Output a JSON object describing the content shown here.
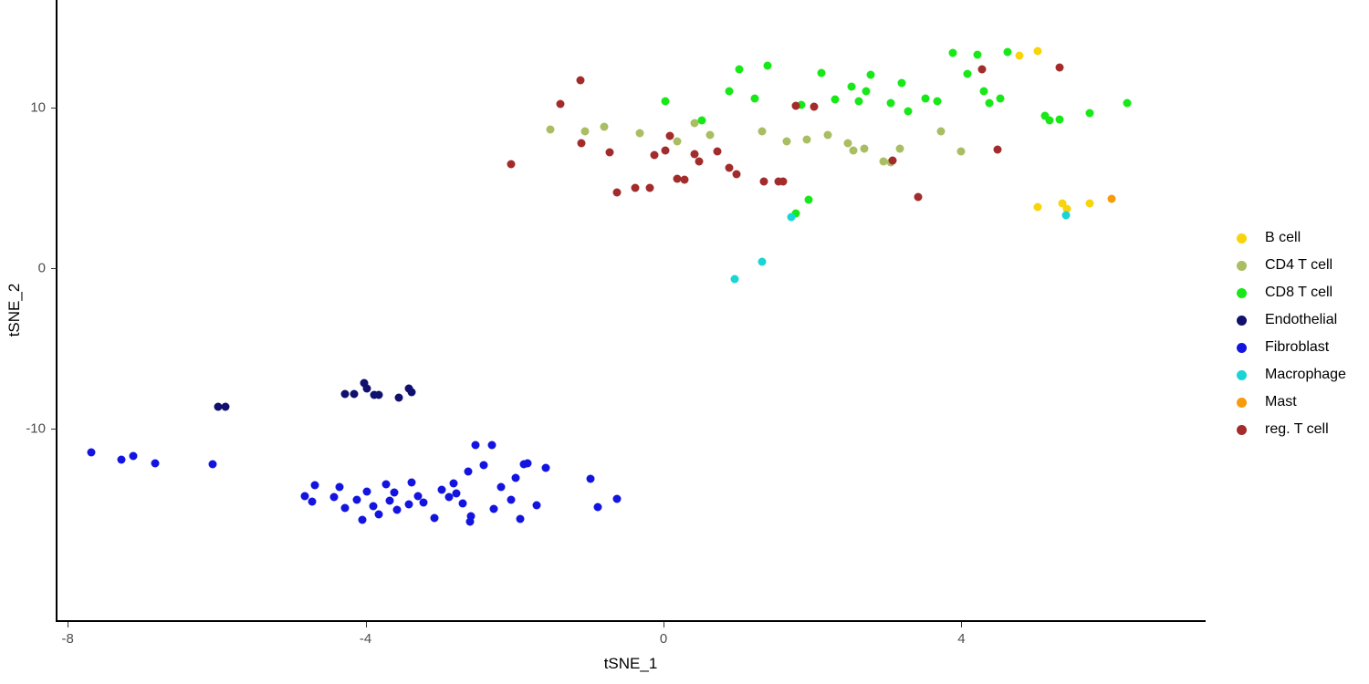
{
  "chart_data": {
    "type": "scatter",
    "title": "",
    "xlabel": "tSNE_1",
    "ylabel": "tSNE_2",
    "xlim": [
      -8.75,
      6.5
    ],
    "ylim": [
      -16.8,
      14.5
    ],
    "xticks": [
      -8,
      -4,
      0,
      4
    ],
    "xticklabels": [
      "-8",
      "-4",
      "0",
      "4"
    ],
    "yticks": [
      -10,
      0,
      10
    ],
    "yticklabels": [
      "-10",
      "0",
      "10"
    ],
    "grid": false,
    "legend_position": "right",
    "point_size": 9,
    "series": [
      {
        "name": "B cell",
        "color": "#f7d40c",
        "points": [
          [
            4.78,
            13.25
          ],
          [
            5.02,
            13.55
          ],
          [
            5.02,
            3.82
          ],
          [
            5.35,
            4.02
          ],
          [
            5.42,
            3.7
          ],
          [
            5.72,
            4.05
          ]
        ]
      },
      {
        "name": "CD4 T cell",
        "color": "#a9bd62",
        "points": [
          [
            -1.52,
            8.65
          ],
          [
            -1.05,
            8.5
          ],
          [
            -0.8,
            8.78
          ],
          [
            -0.32,
            8.4
          ],
          [
            0.18,
            7.92
          ],
          [
            0.42,
            9.02
          ],
          [
            0.62,
            8.3
          ],
          [
            1.32,
            8.55
          ],
          [
            1.65,
            7.88
          ],
          [
            1.92,
            8.02
          ],
          [
            2.2,
            8.28
          ],
          [
            2.48,
            7.78
          ],
          [
            2.55,
            7.32
          ],
          [
            2.7,
            7.42
          ],
          [
            2.95,
            6.62
          ],
          [
            3.05,
            6.6
          ],
          [
            3.18,
            7.45
          ],
          [
            3.72,
            8.5
          ],
          [
            4.0,
            7.25
          ]
        ]
      },
      {
        "name": "CD8 T cell",
        "color": "#18e818",
        "points": [
          [
            0.02,
            10.42
          ],
          [
            0.52,
            9.2
          ],
          [
            0.88,
            11.05
          ],
          [
            1.02,
            12.4
          ],
          [
            1.22,
            10.55
          ],
          [
            1.4,
            12.62
          ],
          [
            1.85,
            10.15
          ],
          [
            2.12,
            12.15
          ],
          [
            2.3,
            10.52
          ],
          [
            2.52,
            11.32
          ],
          [
            2.62,
            10.4
          ],
          [
            2.72,
            11.05
          ],
          [
            2.78,
            12.05
          ],
          [
            3.05,
            10.28
          ],
          [
            3.2,
            11.55
          ],
          [
            3.28,
            9.78
          ],
          [
            3.52,
            10.58
          ],
          [
            3.68,
            10.42
          ],
          [
            3.88,
            13.4
          ],
          [
            4.08,
            12.08
          ],
          [
            4.22,
            13.3
          ],
          [
            4.3,
            11.05
          ],
          [
            4.38,
            10.3
          ],
          [
            4.52,
            10.55
          ],
          [
            4.62,
            13.45
          ],
          [
            5.12,
            9.48
          ],
          [
            5.18,
            9.2
          ],
          [
            5.32,
            9.25
          ],
          [
            5.72,
            9.65
          ],
          [
            6.22,
            10.28
          ],
          [
            1.95,
            4.28
          ],
          [
            1.78,
            3.42
          ]
        ]
      },
      {
        "name": "Endothelial",
        "color": "#10106e",
        "points": [
          [
            -5.98,
            -8.62
          ],
          [
            -5.88,
            -8.62
          ],
          [
            -4.28,
            -7.85
          ],
          [
            -4.15,
            -7.82
          ],
          [
            -4.02,
            -7.15
          ],
          [
            -3.98,
            -7.52
          ],
          [
            -3.88,
            -7.88
          ],
          [
            -3.82,
            -7.88
          ],
          [
            -3.55,
            -8.05
          ],
          [
            -3.42,
            -7.48
          ],
          [
            -3.38,
            -7.75
          ]
        ]
      },
      {
        "name": "Fibroblast",
        "color": "#1414e0",
        "points": [
          [
            -7.68,
            -11.48
          ],
          [
            -7.28,
            -11.95
          ],
          [
            -7.12,
            -11.68
          ],
          [
            -6.82,
            -12.18
          ],
          [
            -6.05,
            -12.22
          ],
          [
            -4.68,
            -13.52
          ],
          [
            -4.82,
            -14.18
          ],
          [
            -4.72,
            -14.52
          ],
          [
            -4.42,
            -14.28
          ],
          [
            -4.35,
            -13.62
          ],
          [
            -4.28,
            -14.95
          ],
          [
            -4.12,
            -14.45
          ],
          [
            -4.05,
            -15.68
          ],
          [
            -3.98,
            -13.92
          ],
          [
            -3.9,
            -14.85
          ],
          [
            -3.82,
            -15.32
          ],
          [
            -3.72,
            -13.45
          ],
          [
            -3.68,
            -14.48
          ],
          [
            -3.62,
            -13.95
          ],
          [
            -3.58,
            -15.08
          ],
          [
            -3.42,
            -14.72
          ],
          [
            -3.38,
            -13.35
          ],
          [
            -3.3,
            -14.22
          ],
          [
            -3.22,
            -14.58
          ],
          [
            -3.08,
            -15.58
          ],
          [
            -2.98,
            -13.78
          ],
          [
            -2.88,
            -14.25
          ],
          [
            -2.82,
            -13.42
          ],
          [
            -2.78,
            -14.02
          ],
          [
            -2.7,
            -14.68
          ],
          [
            -2.62,
            -12.68
          ],
          [
            -2.6,
            -15.82
          ],
          [
            -2.58,
            -15.48
          ],
          [
            -2.52,
            -11.05
          ],
          [
            -2.42,
            -12.25
          ],
          [
            -2.3,
            -11.02
          ],
          [
            -2.28,
            -14.98
          ],
          [
            -2.18,
            -13.62
          ],
          [
            -2.05,
            -14.42
          ],
          [
            -1.98,
            -13.08
          ],
          [
            -1.92,
            -15.62
          ],
          [
            -1.88,
            -12.22
          ],
          [
            -1.82,
            -12.15
          ],
          [
            -1.7,
            -14.78
          ],
          [
            -1.58,
            -12.42
          ],
          [
            -0.98,
            -13.12
          ],
          [
            -0.88,
            -14.88
          ],
          [
            -0.62,
            -14.38
          ]
        ]
      },
      {
        "name": "Macrophage",
        "color": "#1ad5d5",
        "points": [
          [
            0.95,
            -0.68
          ],
          [
            1.32,
            0.42
          ],
          [
            1.72,
            3.18
          ],
          [
            5.4,
            3.28
          ]
        ]
      },
      {
        "name": "Mast",
        "color": "#f59b0c",
        "points": [
          [
            6.02,
            4.32
          ]
        ]
      },
      {
        "name": "reg. T cell",
        "color": "#a22b2b",
        "points": [
          [
            -2.05,
            6.48
          ],
          [
            -1.38,
            10.25
          ],
          [
            -1.12,
            11.7
          ],
          [
            -1.1,
            7.78
          ],
          [
            -0.72,
            7.22
          ],
          [
            -0.62,
            4.72
          ],
          [
            -0.38,
            5.02
          ],
          [
            -0.18,
            4.98
          ],
          [
            -0.12,
            7.05
          ],
          [
            0.02,
            7.35
          ],
          [
            0.08,
            8.22
          ],
          [
            0.18,
            5.55
          ],
          [
            0.28,
            5.5
          ],
          [
            0.42,
            7.12
          ],
          [
            0.48,
            6.65
          ],
          [
            0.72,
            7.28
          ],
          [
            0.88,
            6.25
          ],
          [
            0.98,
            5.88
          ],
          [
            1.35,
            5.38
          ],
          [
            1.55,
            5.38
          ],
          [
            1.6,
            5.4
          ],
          [
            1.78,
            10.12
          ],
          [
            2.02,
            10.08
          ],
          [
            3.08,
            6.7
          ],
          [
            3.42,
            4.45
          ],
          [
            4.28,
            12.38
          ],
          [
            4.48,
            7.38
          ],
          [
            5.32,
            12.52
          ]
        ]
      }
    ]
  },
  "legend": {
    "entries": [
      {
        "label": "B cell",
        "color": "#f7d40c"
      },
      {
        "label": "CD4 T cell",
        "color": "#a9bd62"
      },
      {
        "label": "CD8 T cell",
        "color": "#18e818"
      },
      {
        "label": "Endothelial",
        "color": "#10106e"
      },
      {
        "label": "Fibroblast",
        "color": "#1414e0"
      },
      {
        "label": "Macrophage",
        "color": "#1ad5d5"
      },
      {
        "label": "Mast",
        "color": "#f59b0c"
      },
      {
        "label": "reg. T cell",
        "color": "#a22b2b"
      }
    ]
  }
}
